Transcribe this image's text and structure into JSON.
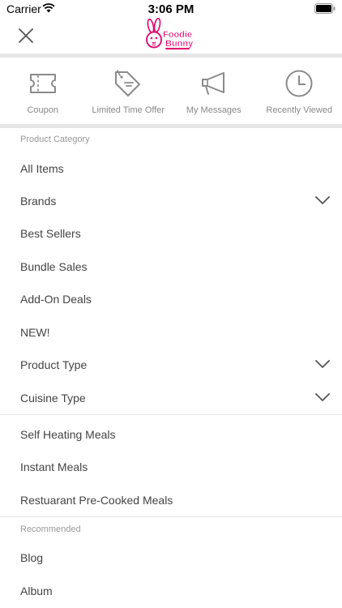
{
  "status_bar": {
    "carrier": "Carrier",
    "time": "3:06 PM"
  },
  "header": {
    "logo_name": "foodie-bunny-logo",
    "logo_line1": "Foodie",
    "logo_line2": "Bunny"
  },
  "quick_links": [
    {
      "label": "Coupon",
      "icon": "coupon-icon"
    },
    {
      "label": "Limited Time Offer",
      "icon": "price-tag-icon"
    },
    {
      "label": "My Messages",
      "icon": "megaphone-icon"
    },
    {
      "label": "Recently Viewed",
      "icon": "clock-icon"
    }
  ],
  "product_category": {
    "heading": "Product Category",
    "items": [
      {
        "label": "All Items"
      },
      {
        "label": "Brands",
        "expandable": true
      },
      {
        "label": "Best Sellers"
      },
      {
        "label": "Bundle Sales"
      },
      {
        "label": "Add-On Deals"
      },
      {
        "label": "NEW!"
      },
      {
        "label": "Product Type",
        "expandable": true
      },
      {
        "label": "Cuisine Type",
        "expandable": true
      }
    ]
  },
  "meal_links": {
    "items": [
      {
        "label": "Self Heating Meals"
      },
      {
        "label": "Instant Meals"
      },
      {
        "label": "Restuarant Pre-Cooked Meals"
      }
    ]
  },
  "recommended": {
    "heading": "Recommended",
    "items": [
      {
        "label": "Blog"
      },
      {
        "label": "Album"
      }
    ]
  },
  "colors": {
    "brand_pink": "#e3006e",
    "divider": "#e6e6e6",
    "icon_gray": "#8a8a8a"
  }
}
